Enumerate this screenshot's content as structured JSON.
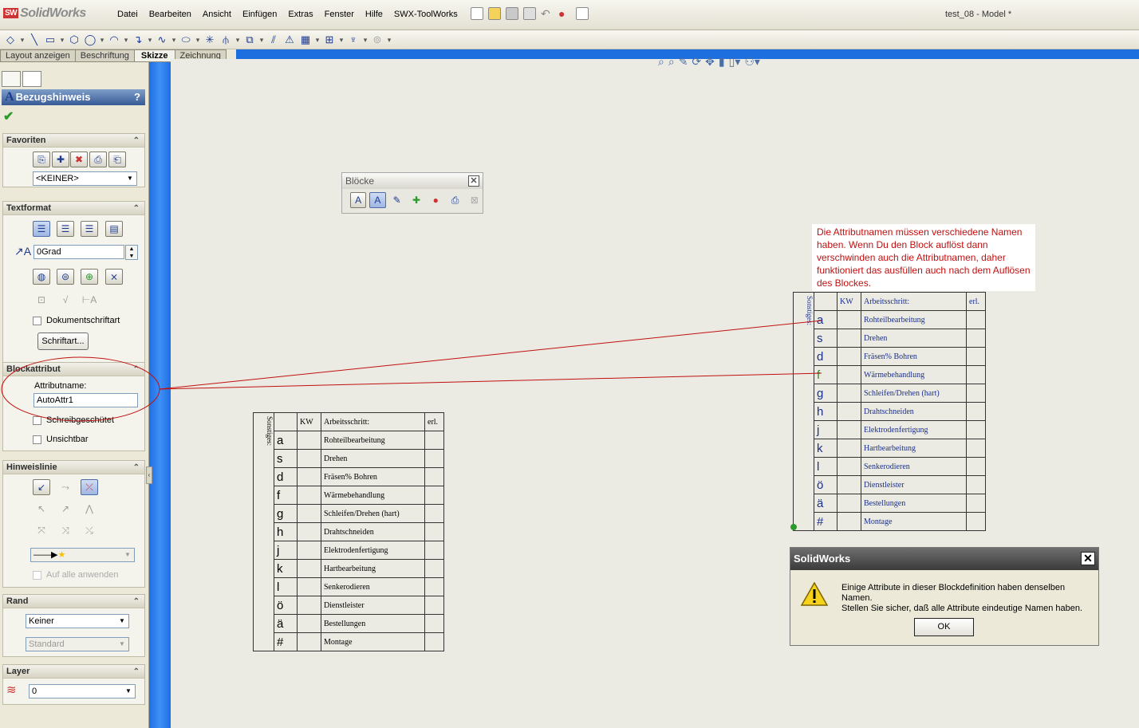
{
  "app": {
    "logo": "SolidWorks",
    "window_title": "test_08 - Model *"
  },
  "menu": [
    "Datei",
    "Bearbeiten",
    "Ansicht",
    "Einfügen",
    "Extras",
    "Fenster",
    "Hilfe",
    "SWX-ToolWorks"
  ],
  "tabs": [
    "Layout anzeigen",
    "Beschriftung",
    "Skizze",
    "Zeichnung"
  ],
  "panel": {
    "title": "Bezugshinweis",
    "help": "?",
    "favoriten": {
      "title": "Favoriten",
      "select": "<KEINER>"
    },
    "textformat": {
      "title": "Textformat",
      "angle": "0Grad",
      "doc_font_label": "Dokumentschriftart",
      "font_button": "Schriftart..."
    },
    "blockattribut": {
      "title": "Blockattribut",
      "attr_label": "Attributname:",
      "attr_value": "AutoAttr1",
      "readonly_label": "Schreibgeschütet",
      "invisible_label": "Unsichtbar"
    },
    "hinweislinie": {
      "title": "Hinweislinie",
      "apply_all_label": "Auf alle anwenden"
    },
    "rand": {
      "title": "Rand",
      "style": "Keiner",
      "size": "Standard"
    },
    "layer": {
      "title": "Layer",
      "value": "0"
    }
  },
  "bloecke": {
    "title": "Blöcke"
  },
  "table": {
    "header": {
      "vertical": "Sonstiges:",
      "kw": "KW",
      "step": "Arbeitsschritt:",
      "done": "erl."
    },
    "rows": [
      {
        "letter": "a",
        "step": "Rohteilbearbeitung"
      },
      {
        "letter": "s",
        "step": "Drehen"
      },
      {
        "letter": "d",
        "step": "Fräsen% Bohren"
      },
      {
        "letter": "f",
        "step": "Wärmebehandlung"
      },
      {
        "letter": "g",
        "step": "Schleifen/Drehen (hart)"
      },
      {
        "letter": "h",
        "step": "Drahtschneiden"
      },
      {
        "letter": "j",
        "step": "Elektrodenfertigung"
      },
      {
        "letter": "k",
        "step": "Hartbearbeitung"
      },
      {
        "letter": "l",
        "step": "Senkerodieren"
      },
      {
        "letter": "ö",
        "step": "Dienstleister"
      },
      {
        "letter": "ä",
        "step": "Bestellungen"
      },
      {
        "letter": "#",
        "step": "Montage"
      }
    ]
  },
  "note": "Die Attributnamen  müssen verschiedene Namen haben. Wenn Du den Block auflöst dann verschwinden auch die Attributnamen, daher funktioniert das ausfüllen auch nach dem Auflösen des Blockes.",
  "dialog": {
    "title": "SolidWorks",
    "line1": "Einige Attribute in dieser Blockdefinition haben denselben Namen.",
    "line2": "Stellen Sie sicher, daß alle Attribute eindeutige Namen haben.",
    "ok": "OK"
  },
  "colors": {
    "accent": "#1d6fe0",
    "annotation": "#c0100f",
    "block_text": "#1a2f8a"
  }
}
